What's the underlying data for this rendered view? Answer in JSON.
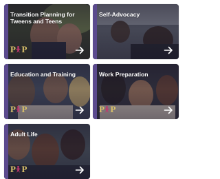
{
  "cards": [
    {
      "title": "Transition Planning for Tweens and Teens",
      "photo": "teens-outdoors-photo"
    },
    {
      "title": "Self-Advocacy",
      "photo": "classroom-photo"
    },
    {
      "title": "Education and Training",
      "photo": "students-studying-photo"
    },
    {
      "title": "Work Preparation",
      "photo": "office-meeting-photo"
    },
    {
      "title": "Adult Life",
      "photo": "friends-group-photo"
    }
  ],
  "logo": {
    "left": "P",
    "right": "P",
    "mark": "star-figure-icon"
  },
  "icons": {
    "arrow": "arrow-right-icon"
  },
  "colors": {
    "accent": "#5b4a8e",
    "logo_gold": "#d8c06a",
    "logo_mark": "#c0386e",
    "text": "#ffffff",
    "page_bg": "#ffffff"
  }
}
